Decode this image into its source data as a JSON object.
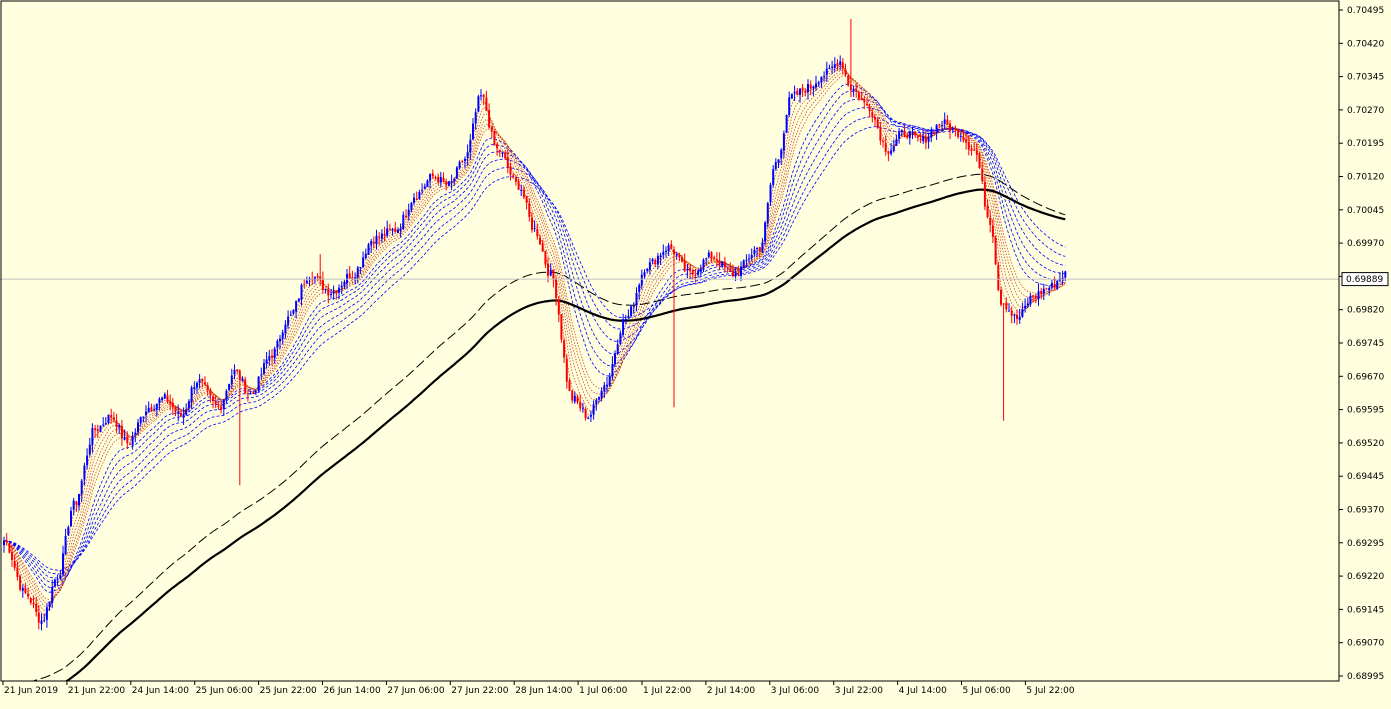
{
  "chart_data": {
    "type": "candlestick",
    "title": "",
    "xlabel": "",
    "ylabel": "",
    "ylim": [
      0.68995,
      0.70495
    ],
    "y_ticks": [
      "0.70495",
      "0.70420",
      "0.70345",
      "0.70270",
      "0.70195",
      "0.70120",
      "0.70045",
      "0.69970",
      "0.69895",
      "0.69820",
      "0.69745",
      "0.69670",
      "0.69595",
      "0.69520",
      "0.69445",
      "0.69370",
      "0.69295",
      "0.69220",
      "0.69145",
      "0.69070",
      "0.68995"
    ],
    "x_ticks": [
      "21 Jun 2019",
      "21 Jun 22:00",
      "24 Jun 14:00",
      "25 Jun 06:00",
      "25 Jun 22:00",
      "26 Jun 14:00",
      "27 Jun 06:00",
      "27 Jun 22:00",
      "28 Jun 14:00",
      "1 Jul 06:00",
      "1 Jul 22:00",
      "2 Jul 14:00",
      "3 Jul 06:00",
      "3 Jul 22:00",
      "4 Jul 14:00",
      "5 Jul 06:00",
      "5 Jul 22:00"
    ],
    "current_price": "0.69889",
    "colors": {
      "background": "#ffffe0",
      "bull": "#0000ff",
      "bear": "#ff0000",
      "long_ma": "#000000",
      "fast_ma_band": "#cc3300",
      "slow_ma_band": "#0000ff",
      "price_line": "#c0c0c0"
    },
    "anchors": [
      [
        0,
        0.693
      ],
      [
        8,
        0.6918
      ],
      [
        14,
        0.6912
      ],
      [
        20,
        0.6922
      ],
      [
        26,
        0.6938
      ],
      [
        34,
        0.6955
      ],
      [
        40,
        0.6958
      ],
      [
        46,
        0.6952
      ],
      [
        54,
        0.696
      ],
      [
        60,
        0.6962
      ],
      [
        66,
        0.6958
      ],
      [
        72,
        0.6966
      ],
      [
        80,
        0.696
      ],
      [
        86,
        0.6968
      ],
      [
        92,
        0.6963
      ],
      [
        100,
        0.6972
      ],
      [
        106,
        0.698
      ],
      [
        114,
        0.699
      ],
      [
        122,
        0.6986
      ],
      [
        130,
        0.699
      ],
      [
        138,
        0.6998
      ],
      [
        146,
        0.7
      ],
      [
        154,
        0.7008
      ],
      [
        160,
        0.7012
      ],
      [
        166,
        0.701
      ],
      [
        172,
        0.7016
      ],
      [
        178,
        0.703
      ],
      [
        184,
        0.7018
      ],
      [
        192,
        0.701
      ],
      [
        198,
        0.7
      ],
      [
        204,
        0.699
      ],
      [
        212,
        0.6962
      ],
      [
        218,
        0.6958
      ],
      [
        224,
        0.6965
      ],
      [
        232,
        0.698
      ],
      [
        240,
        0.6992
      ],
      [
        248,
        0.6996
      ],
      [
        256,
        0.699
      ],
      [
        264,
        0.6994
      ],
      [
        272,
        0.699
      ],
      [
        282,
        0.6996
      ],
      [
        288,
        0.7015
      ],
      [
        294,
        0.703
      ],
      [
        300,
        0.7032
      ],
      [
        306,
        0.7035
      ],
      [
        312,
        0.7038
      ],
      [
        316,
        0.7032
      ],
      [
        322,
        0.7028
      ],
      [
        330,
        0.7018
      ],
      [
        336,
        0.7022
      ],
      [
        342,
        0.702
      ],
      [
        350,
        0.7024
      ],
      [
        356,
        0.7022
      ],
      [
        362,
        0.7018
      ],
      [
        368,
        0.7002
      ],
      [
        372,
        0.6984
      ],
      [
        378,
        0.698
      ],
      [
        384,
        0.6985
      ],
      [
        390,
        0.6987
      ],
      [
        396,
        0.699
      ]
    ],
    "wicks": [
      {
        "index": 88,
        "price": 0.69425
      },
      {
        "index": 118,
        "price": 0.69945
      },
      {
        "index": 250,
        "price": 0.696
      },
      {
        "index": 316,
        "price": 0.70475
      },
      {
        "index": 373,
        "price": 0.6957
      }
    ]
  }
}
